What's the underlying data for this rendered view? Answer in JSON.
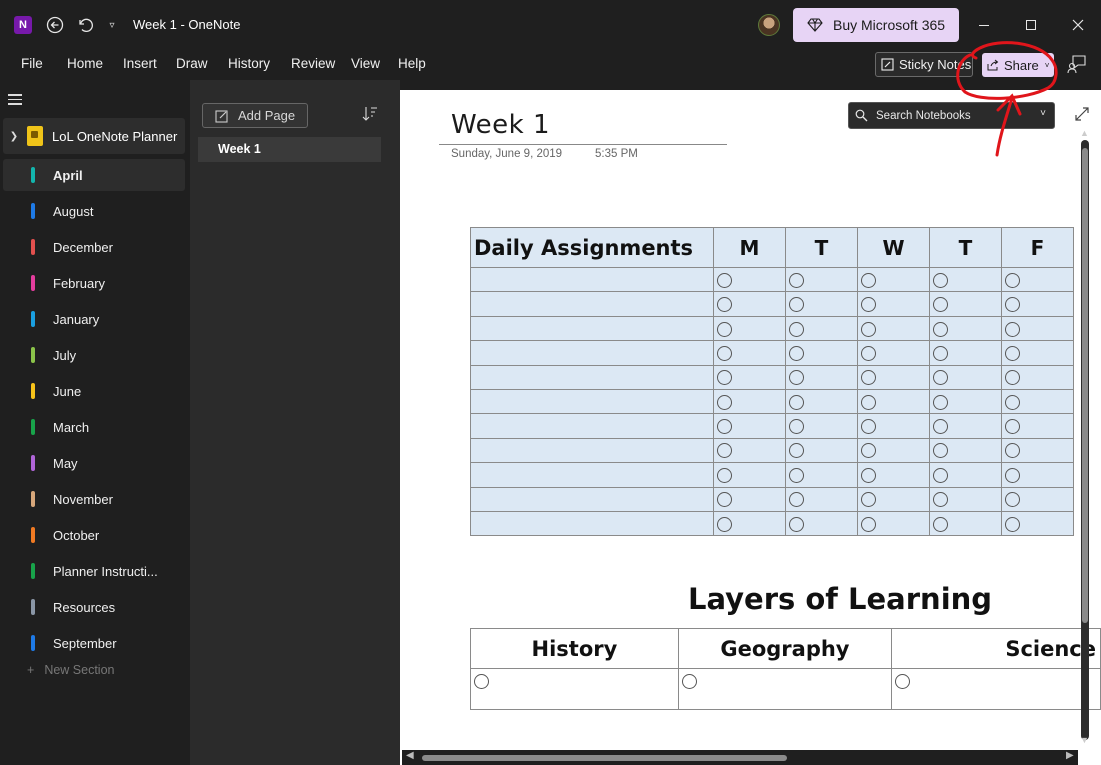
{
  "titlebar": {
    "title": "Week 1  -  OneNote",
    "buy_label": "Buy Microsoft 365",
    "app_icon_glyph": "N"
  },
  "menu": {
    "items": [
      "File",
      "Home",
      "Insert",
      "Draw",
      "History",
      "Review",
      "View",
      "Help"
    ],
    "sticky_notes_label": "Sticky Notes",
    "share_label": "Share"
  },
  "nav": {
    "notebook_name": "LoL OneNote Planner",
    "sections": [
      {
        "label": "April",
        "color": "#13b5ad",
        "active": true
      },
      {
        "label": "August",
        "color": "#1e7ae6"
      },
      {
        "label": "December",
        "color": "#e2504e"
      },
      {
        "label": "February",
        "color": "#e43d9d"
      },
      {
        "label": "January",
        "color": "#1a9fe0"
      },
      {
        "label": "July",
        "color": "#8bc34a"
      },
      {
        "label": "June",
        "color": "#f7c31a"
      },
      {
        "label": "March",
        "color": "#18a34a"
      },
      {
        "label": "May",
        "color": "#b065d8"
      },
      {
        "label": "November",
        "color": "#d7a77b"
      },
      {
        "label": "October",
        "color": "#f07a23"
      },
      {
        "label": "Planner Instructi...",
        "color": "#18a34a"
      },
      {
        "label": "Resources",
        "color": "#8a96a6"
      },
      {
        "label": "September",
        "color": "#1e7ae6"
      }
    ],
    "new_section_label": "New Section"
  },
  "pages": {
    "add_page_label": "Add Page",
    "items": [
      "Week 1"
    ]
  },
  "page": {
    "title": "Week 1",
    "date": "Sunday, June 9, 2019",
    "time": "5:35 PM",
    "search_placeholder": "Search Notebooks",
    "assignments": {
      "header": "Daily Assignments",
      "days": [
        "M",
        "T",
        "W",
        "T",
        "F"
      ],
      "row_count": 11
    },
    "lol_heading": "Layers of Learning",
    "subjects": [
      "History",
      "Geography",
      "Science"
    ]
  },
  "colors": {
    "accent": "#e7d4f5",
    "table_fill": "#dce8f4",
    "annotation": "#e0151b"
  }
}
